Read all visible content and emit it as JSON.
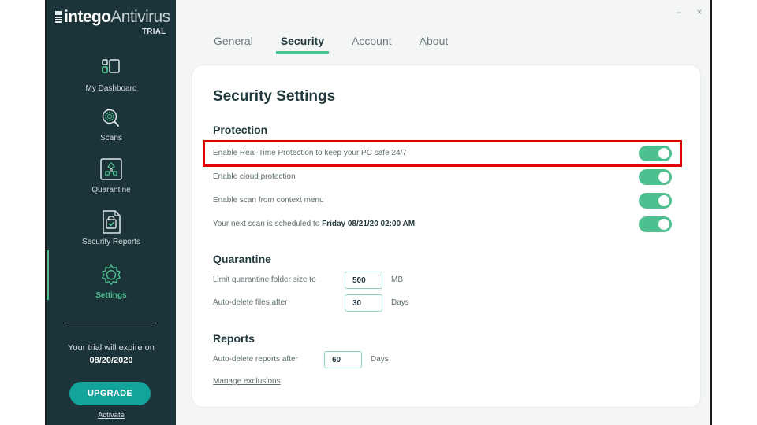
{
  "app": {
    "brand_bold": "intego",
    "brand_light": "Antivirus",
    "edition": "TRIAL"
  },
  "window_controls": {
    "minimize": "–",
    "close": "×"
  },
  "sidebar": {
    "items": [
      {
        "label": "My Dashboard",
        "icon": "dashboard-icon"
      },
      {
        "label": "Scans",
        "icon": "scan-magnifier-icon"
      },
      {
        "label": "Quarantine",
        "icon": "biohazard-icon"
      },
      {
        "label": "Security Reports",
        "icon": "report-document-icon"
      },
      {
        "label": "Settings",
        "icon": "gear-icon",
        "active": true
      }
    ],
    "trial_text": "Your trial will expire on",
    "trial_date": "08/20/2020",
    "upgrade_label": "UPGRADE",
    "activate_label": "Activate"
  },
  "tabs": [
    {
      "label": "General"
    },
    {
      "label": "Security",
      "active": true
    },
    {
      "label": "Account"
    },
    {
      "label": "About"
    }
  ],
  "settings": {
    "title": "Security Settings",
    "protection": {
      "heading": "Protection",
      "rows": [
        {
          "label": "Enable Real-Time Protection to keep your PC safe 24/7",
          "enabled": true,
          "highlighted": true
        },
        {
          "label": "Enable cloud protection",
          "enabled": true
        },
        {
          "label": "Enable scan from context menu",
          "enabled": true
        },
        {
          "label_prefix": "Your next scan is scheduled to ",
          "label_bold": "Friday 08/21/20 02:00 AM",
          "enabled": true
        }
      ]
    },
    "quarantine": {
      "heading": "Quarantine",
      "folder_limit_label": "Limit quarantine folder size to",
      "folder_limit_value": "500",
      "folder_limit_unit": "MB",
      "auto_delete_label": "Auto-delete files after",
      "auto_delete_value": "30",
      "auto_delete_unit": "Days"
    },
    "reports": {
      "heading": "Reports",
      "auto_delete_label": "Auto-delete reports after",
      "auto_delete_value": "60",
      "auto_delete_unit": "Days",
      "manage_link": "Manage exclusions"
    }
  },
  "colors": {
    "sidebar_bg": "#1b3439",
    "accent_green": "#4ec08f",
    "upgrade_teal": "#12a39a",
    "highlight_red": "#e00000"
  }
}
